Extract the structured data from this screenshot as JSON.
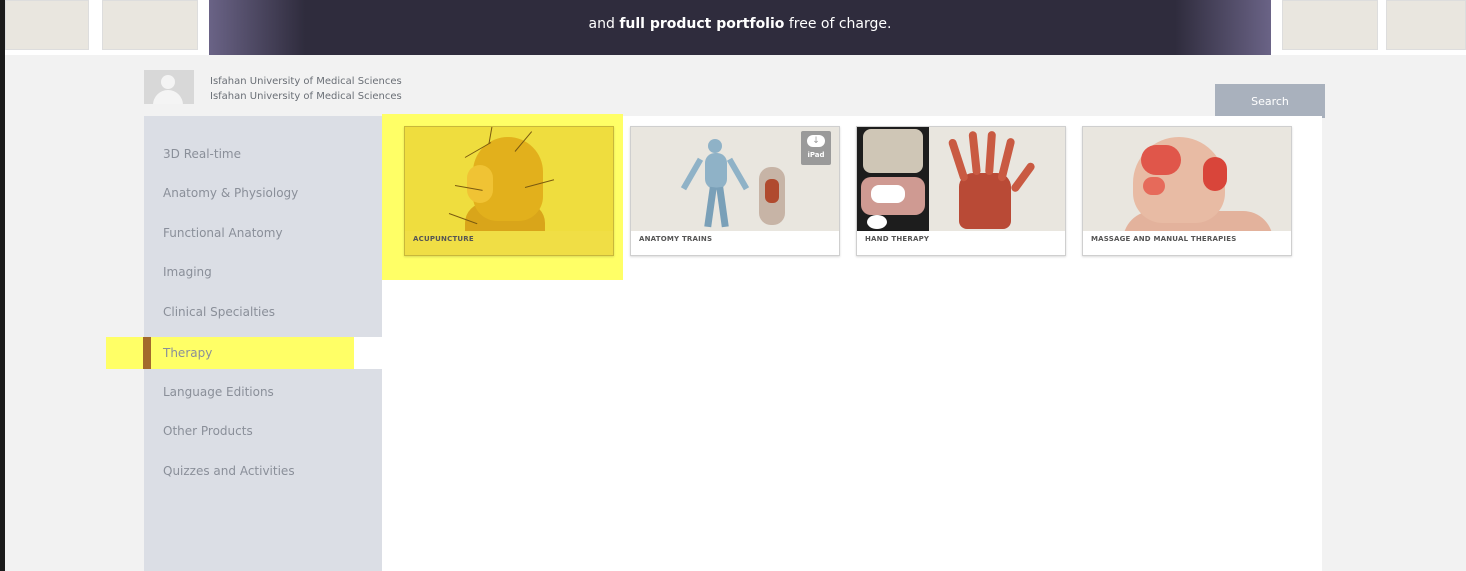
{
  "top_strip": {
    "thumbs": [
      "",
      "",
      "",
      ""
    ],
    "banner": {
      "text_before": "and ",
      "text_bold": "full product portfolio",
      "text_after": " free of charge."
    }
  },
  "institution": {
    "line1": "Isfahan University of Medical Sciences",
    "line2": "Isfahan University of Medical Sciences"
  },
  "search_button": "Search",
  "sidebar": {
    "items": [
      "3D Real-time",
      "Anatomy & Physiology",
      "Functional Anatomy",
      "Imaging",
      "Clinical Specialties",
      "Therapy",
      "Language Editions",
      "Other Products",
      "Quizzes and Activities"
    ],
    "active_index": 5
  },
  "products": [
    {
      "label": "ACUPUNCTURE",
      "highlighted": true
    },
    {
      "label": "ANATOMY TRAINS",
      "badge": "iPad"
    },
    {
      "label": "HAND THERAPY"
    },
    {
      "label": "MASSAGE AND MANUAL THERAPIES"
    }
  ],
  "colors": {
    "highlight": "#ffff66",
    "sidebar_bg": "#dbdee5",
    "banner_bg": "#2f2c3d",
    "active_marker": "#a26a2c"
  }
}
